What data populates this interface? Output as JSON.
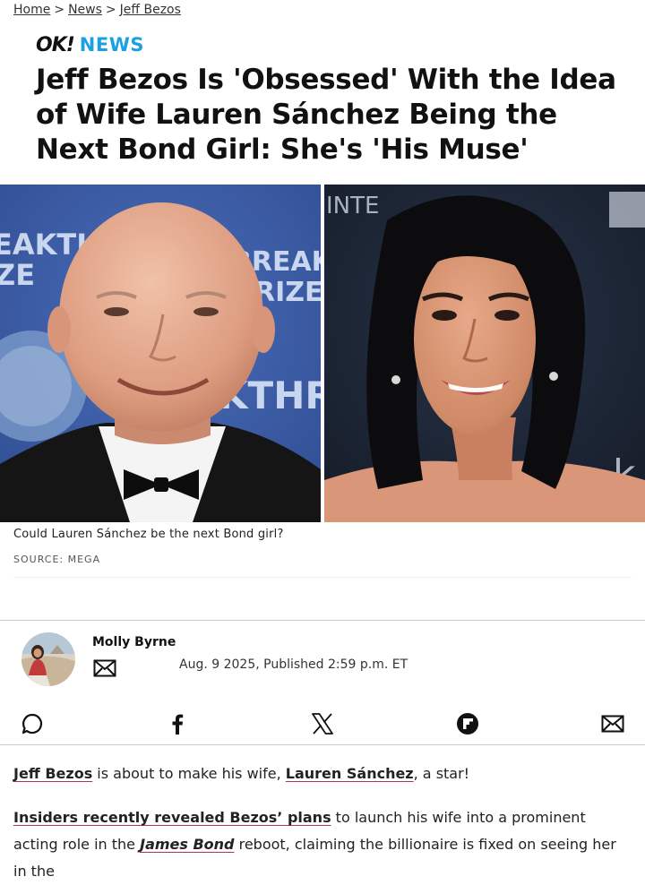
{
  "breadcrumb": {
    "home": "Home",
    "news": "News",
    "current": "Jeff Bezos",
    "sep": ">"
  },
  "logo": {
    "ok": "OK!",
    "news": "NEWS"
  },
  "headline": "Jeff Bezos Is 'Obsessed' With the Idea of Wife Lauren Sánchez Being the Next Bond Girl: She's 'His Muse'",
  "photo": {
    "left_sign_text": [
      "EAKTH",
      "ZE",
      "BREAKT",
      "PRIZE",
      "KTHR"
    ],
    "right_sign_text": [
      "INTE",
      "k"
    ],
    "caption": "Could Lauren Sánchez be the next Bond girl?",
    "source": "SOURCE: MEGA"
  },
  "byline": {
    "author": "Molly Byrne",
    "date": "Aug. 9 2025, Published 2:59 p.m. ET"
  },
  "share_icons": [
    "comment-icon",
    "facebook-icon",
    "x-icon",
    "flipboard-icon",
    "email-icon"
  ],
  "body": {
    "p1": {
      "link1": "Jeff Bezos",
      "t1": " is about to make his wife, ",
      "link2": "Lauren Sánchez",
      "t2": ", a star!"
    },
    "p2": {
      "link1": "Insiders recently revealed Bezos’ plans",
      "t1": " to launch his wife into a prominent acting role in the ",
      "link2": "James Bond",
      "t2": " reboot, claiming the billionaire is fixed on seeing her in the"
    }
  },
  "colors": {
    "news_blue": "#1aa1e5",
    "link_underline": "#b0306a"
  }
}
